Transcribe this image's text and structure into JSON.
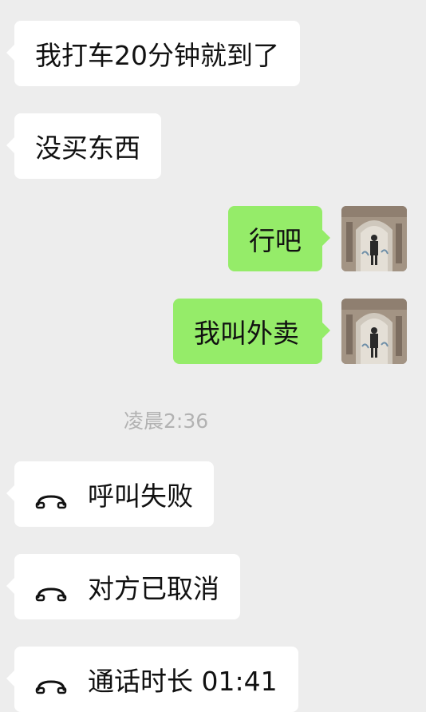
{
  "messages": {
    "m1": "我打车20分钟就到了",
    "m2": "没买东西",
    "m3": "行吧",
    "m4": "我叫外卖"
  },
  "timestamp": "凌晨2:36",
  "calls": {
    "c1": "呼叫失败",
    "c2": "对方已取消",
    "c3": "通话时长 01:41"
  },
  "colors": {
    "background": "#ededed",
    "incoming_bubble": "#ffffff",
    "outgoing_bubble": "#95ec69",
    "timestamp_text": "#b2b2b2"
  },
  "icons": {
    "call": "phone-hangup-icon"
  }
}
